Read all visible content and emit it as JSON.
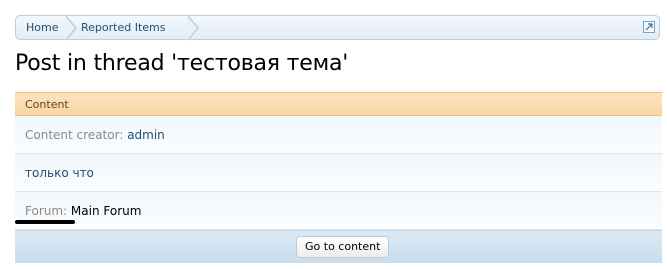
{
  "breadcrumb": {
    "home": "Home",
    "reported_items": "Reported Items"
  },
  "page": {
    "title": "Post in thread 'тестовая тема'"
  },
  "section": {
    "header": "Content",
    "creator_label": "Content creator:",
    "creator_value": "admin",
    "time": "только что",
    "forum_label": "Forum:",
    "forum_value": "Main Forum"
  },
  "footer": {
    "button": "Go to content"
  },
  "icons": {
    "jump": "external-link-icon"
  }
}
